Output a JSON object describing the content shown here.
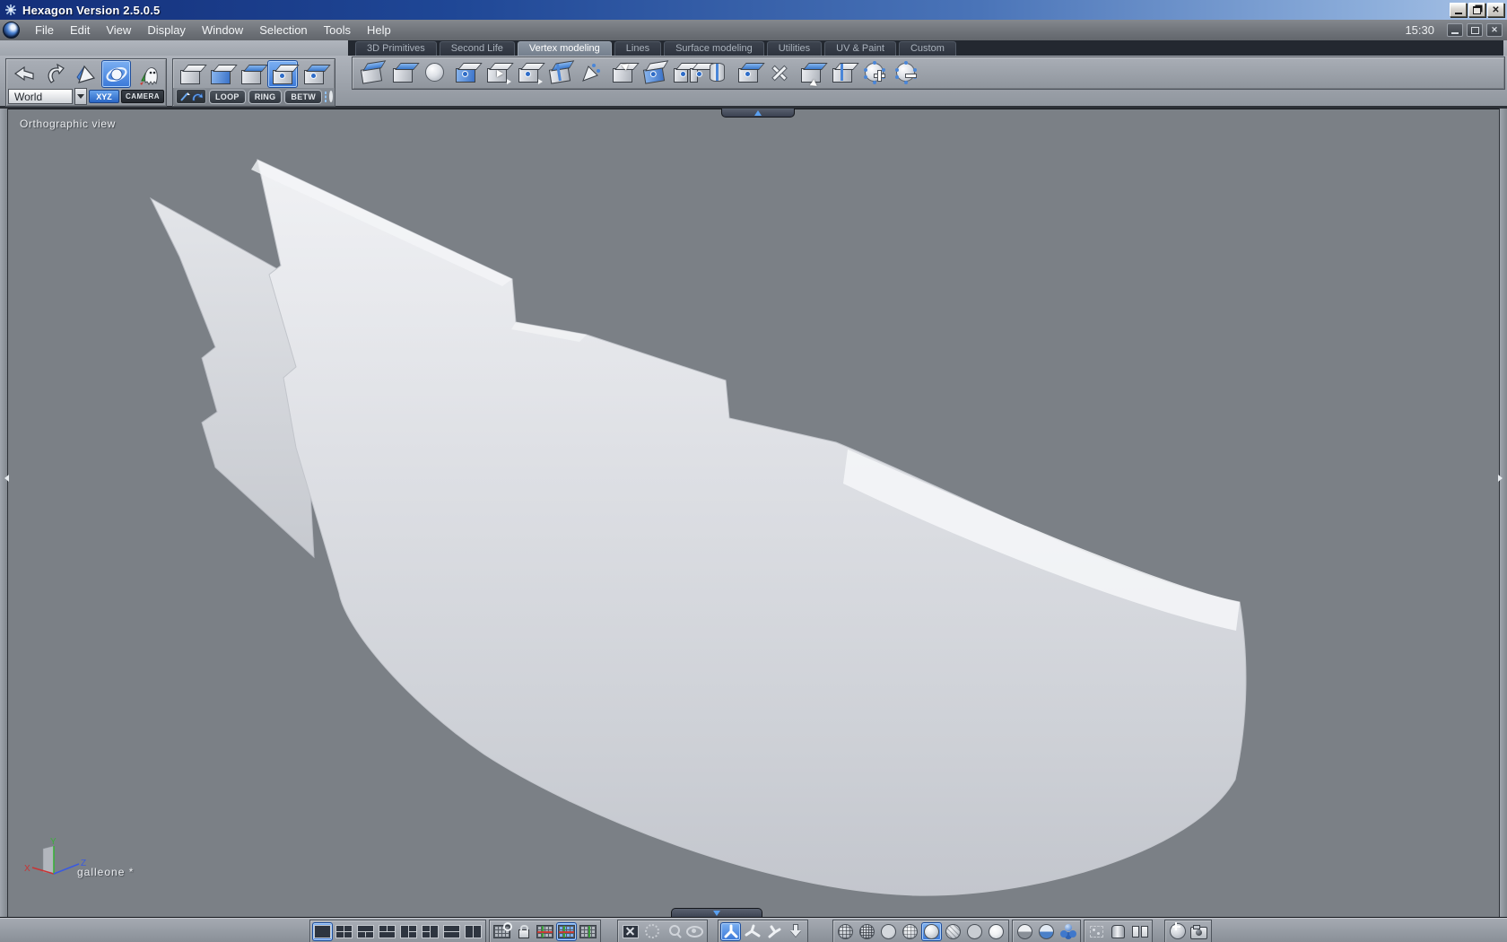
{
  "window": {
    "title": "Hexagon Version 2.5.0.5",
    "time": "15:30",
    "controls": {
      "minimize": "_",
      "restore": "❐",
      "maximize": "□",
      "close": "✕"
    }
  },
  "menu": {
    "items": [
      "File",
      "Edit",
      "View",
      "Display",
      "Window",
      "Selection",
      "Tools",
      "Help"
    ]
  },
  "tabs": [
    {
      "label": "3D Primitives",
      "active": false
    },
    {
      "label": "Second Life",
      "active": false
    },
    {
      "label": "Vertex modeling",
      "active": true
    },
    {
      "label": "Lines",
      "active": false
    },
    {
      "label": "Surface modeling",
      "active": false
    },
    {
      "label": "Utilities",
      "active": false
    },
    {
      "label": "UV & Paint",
      "active": false
    },
    {
      "label": "Custom",
      "active": false
    }
  ],
  "toolbar": {
    "history": {
      "icons": [
        "undo-icon",
        "redo-icon",
        "select-transform-icon",
        "universal-manipulator-sphere-icon",
        "dynamic-geometry-ghost-icon"
      ],
      "selected": "universal-manipulator-sphere-icon"
    },
    "workspace": {
      "dropdown_value": "World",
      "xyz_label": "XYZ",
      "camera_label": "CAMERA"
    },
    "selection_modes": {
      "icons": [
        "select-object-cube",
        "select-face-cube",
        "select-edge-cube",
        "select-vertex-cube",
        "select-auto-cube"
      ],
      "selected_index": 3
    },
    "selection_tools": {
      "loop": "LOOP",
      "ring": "RING",
      "betw": "BETW",
      "extras": [
        "paint-select-icon",
        "lasso-select-icon",
        "marquee-select-icon",
        "ellipse-select-icon"
      ]
    },
    "vertex_modeling_tools": [
      "chamfer",
      "extrude-face",
      "tessellate-smooth",
      "inset",
      "copy-panel",
      "tweak",
      "bend",
      "soft-selection",
      "flip",
      "stretch",
      "bridge",
      "weld",
      "close-hole",
      "sweep",
      "extrude-curl",
      "mirror",
      "smooth-plus",
      "smooth-minus"
    ],
    "flyout_marker_indices": [
      4,
      5
    ]
  },
  "viewport": {
    "label": "Orthographic view",
    "model_name": "galleone *",
    "axes": {
      "x": "X",
      "y": "Y",
      "z": "Z"
    }
  },
  "bottombar": {
    "layouts": {
      "icons": [
        "layout-single",
        "layout-quad",
        "layout-top1-bottom2",
        "layout-top2-bottom1",
        "layout-left1-right2",
        "layout-left2-right1",
        "layout-2-rows",
        "layout-2-cols"
      ],
      "selected_index": 0
    },
    "grids": {
      "icons": [
        "grid-link",
        "grid-lock",
        "grid-front",
        "grid-top",
        "grid-right"
      ],
      "selected_index": 3
    },
    "view_tools": [
      "fit-view",
      "pan-view",
      "zoom-region",
      "visibility-eye"
    ],
    "manipulators": {
      "icons": [
        "manipulator-universal",
        "manipulator-move",
        "manipulator-rotate",
        "manipulator-menu-arrow"
      ],
      "selected_index": 0
    },
    "shading_modes": {
      "icons": [
        "wireframe",
        "hidden-line",
        "flat-shaded",
        "shaded-wireframe",
        "smooth-shaded",
        "textured-wireframe",
        "flat-no-wire",
        "bright-shaded"
      ],
      "selected_index": 4
    },
    "display_extras": [
      "backface-half",
      "transparent-half",
      "multi-select-spheres"
    ],
    "object_display": [
      "ghost-cube",
      "open-cylinder",
      "clone-panels"
    ],
    "render": [
      "render-sphere",
      "camera-snapshot"
    ]
  },
  "colors": {
    "accent_blue": "#4a8ae0",
    "titlebar_left": "#142f7a",
    "titlebar_right": "#a8c2e6",
    "toolbar_gray": "#9aa0a8",
    "viewport_gray": "#7b8086",
    "tab_dark": "#232830",
    "hull_light": "#eef0f2",
    "hull_mid": "#d2d5da",
    "axis_x": "#c83434",
    "axis_y": "#3ab03a",
    "axis_z": "#3a5ae0"
  }
}
